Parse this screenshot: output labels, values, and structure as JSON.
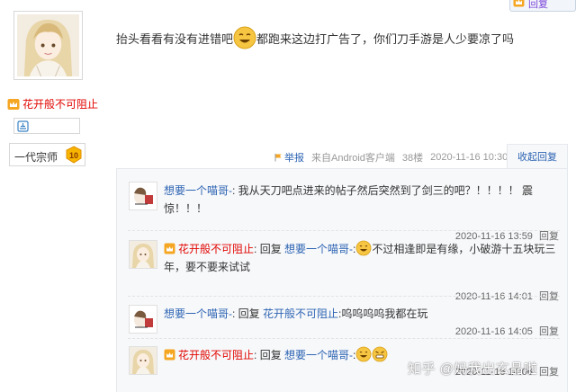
{
  "author": {
    "name": "花开般不可阻止",
    "level_title": "一代宗师",
    "level_number": "10",
    "name_color": "#e10602"
  },
  "top_tab": {
    "label": "回复"
  },
  "post": {
    "text_before_emoji": "抬头看看有没有进错吧",
    "text_after_emoji": "都跑来这边打广告了，你们刀手游是人少要凉了吗",
    "report_label": "举报",
    "client": "来自Android客户端",
    "floor": "38楼",
    "time": "2020-11-16 10:30",
    "collapse_label": "收起回复"
  },
  "replies": [
    {
      "user": "想要一个喵哥-",
      "text": "我从天刀吧点进来的帖子然后突然到了剑三的吧？！！！！ 震惊！！！",
      "time": "2020-11-16 13:59",
      "reply_label": "回复"
    },
    {
      "user": "花开般不可阻止",
      "reply_word": "回复",
      "target": "想要一个喵哥-",
      "text": "不过相逢即是有缘，小破游十五块玩三年，要不要来试试",
      "time": "2020-11-16 14:01",
      "reply_label": "回复"
    },
    {
      "user": "想要一个喵哥-",
      "reply_word": "回复",
      "target": "花开般不可阻止",
      "text": "呜呜呜呜我都在玩",
      "time": "2020-11-16 14:05",
      "reply_label": "回复"
    },
    {
      "user": "花开般不可阻止",
      "reply_word": "回复",
      "target": "想要一个喵哥-",
      "text": "",
      "time": "2020-11-16 14:06",
      "reply_label": "回复"
    }
  ],
  "watermark": "知乎 @妈我出玄晶啦",
  "colors": {
    "link_blue": "#2d64b3",
    "vip_red": "#e10602",
    "lzl_bg": "#f7f8fa",
    "meta_gray": "#999999"
  }
}
